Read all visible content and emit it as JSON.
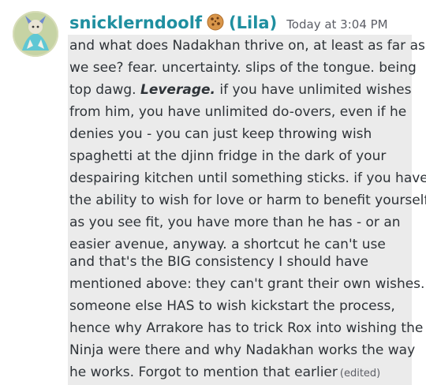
{
  "message": {
    "author": {
      "username": "snicklerndoolf",
      "badge_icon": "cookie-icon",
      "nickname": "(Lila)",
      "name_color": "#1f8fa0"
    },
    "timestamp": "Today at 3:04 PM",
    "paragraph1": {
      "line1": "and what does Nadakhan thrive on, at least as far as",
      "line2": "we see? fear. uncertainty. slips of the tongue. being",
      "line3_before": "top dawg. ",
      "line3_emph": "Leverage.",
      "line3_after": " if you have unlimited wishes",
      "line4": "from him, you have unlimited do-overs, even if he",
      "line5": "denies you - you can just keep throwing wish",
      "line6": "spaghetti at the djinn fridge in the dark of your",
      "line7": "despairing kitchen until something sticks. if you have",
      "line8": "the ability to wish for love or harm to benefit yourself",
      "line9": "as you see fit, you have more than he has - or an",
      "line10": "easier avenue, anyway. a shortcut he can't use"
    },
    "paragraph2": {
      "line1": "and that's the BIG consistency I should have",
      "line2": "mentioned above: they can't grant their own wishes.",
      "line3": "someone else HAS to wish kickstart the process,",
      "line4": "hence why Arrakore has to trick Rox into wishing the",
      "line5": "Ninja were there and why Nadakhan works the way",
      "line6": "he works. Forgot to mention that earlier"
    },
    "edited_label": "(edited)",
    "highlight_color": "#ebebeb"
  }
}
